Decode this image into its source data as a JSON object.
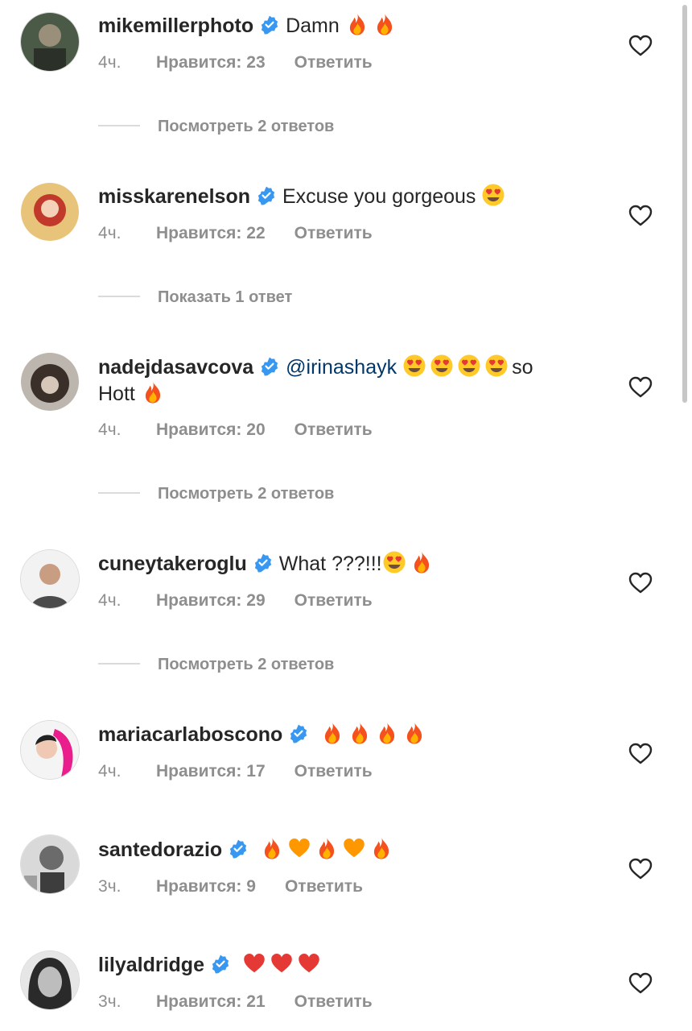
{
  "comments": [
    {
      "username": "mikemillerphoto",
      "text": "Damn",
      "emojis": [
        "fire",
        "fire"
      ],
      "time": "4ч.",
      "likes": "Нравится: 23",
      "reply": "Ответить",
      "replies": "Посмотреть 2 ответов"
    },
    {
      "username": "misskarenelson",
      "text": "Excuse you gorgeous",
      "emojis": [
        "heart-eyes"
      ],
      "time": "4ч.",
      "likes": "Нравится: 22",
      "reply": "Ответить",
      "replies": "Показать 1 ответ"
    },
    {
      "username": "nadejdasavcova",
      "mention": "@irinashayk",
      "text_after": "so",
      "line2_text": "Hott",
      "emojis": [
        "heart-eyes",
        "heart-eyes",
        "heart-eyes",
        "heart-eyes"
      ],
      "line2_emojis": [
        "fire"
      ],
      "time": "4ч.",
      "likes": "Нравится: 20",
      "reply": "Ответить",
      "replies": "Посмотреть 2 ответов"
    },
    {
      "username": "cuneytakeroglu",
      "text": "What ???!!!",
      "emojis": [
        "heart-eyes",
        "fire"
      ],
      "time": "4ч.",
      "likes": "Нравится: 29",
      "reply": "Ответить",
      "replies": "Посмотреть 2 ответов"
    },
    {
      "username": "mariacarlaboscono",
      "text": "",
      "emojis": [
        "fire",
        "fire",
        "fire",
        "fire"
      ],
      "time": "4ч.",
      "likes": "Нравится: 17",
      "reply": "Ответить"
    },
    {
      "username": "santedorazio",
      "text": "",
      "emojis": [
        "fire",
        "orange-heart",
        "fire",
        "orange-heart",
        "fire"
      ],
      "time": "3ч.",
      "likes": "Нравится: 9",
      "reply": "Ответить"
    },
    {
      "username": "lilyaldridge",
      "text": "",
      "emojis": [
        "red-heart",
        "red-heart",
        "red-heart"
      ],
      "time": "3ч.",
      "likes": "Нравится: 21",
      "reply": "Ответить"
    }
  ],
  "colors": {
    "text": "#262626",
    "secondary": "#8e8e8e",
    "verified": "#3897f0",
    "mention": "#00376b"
  }
}
